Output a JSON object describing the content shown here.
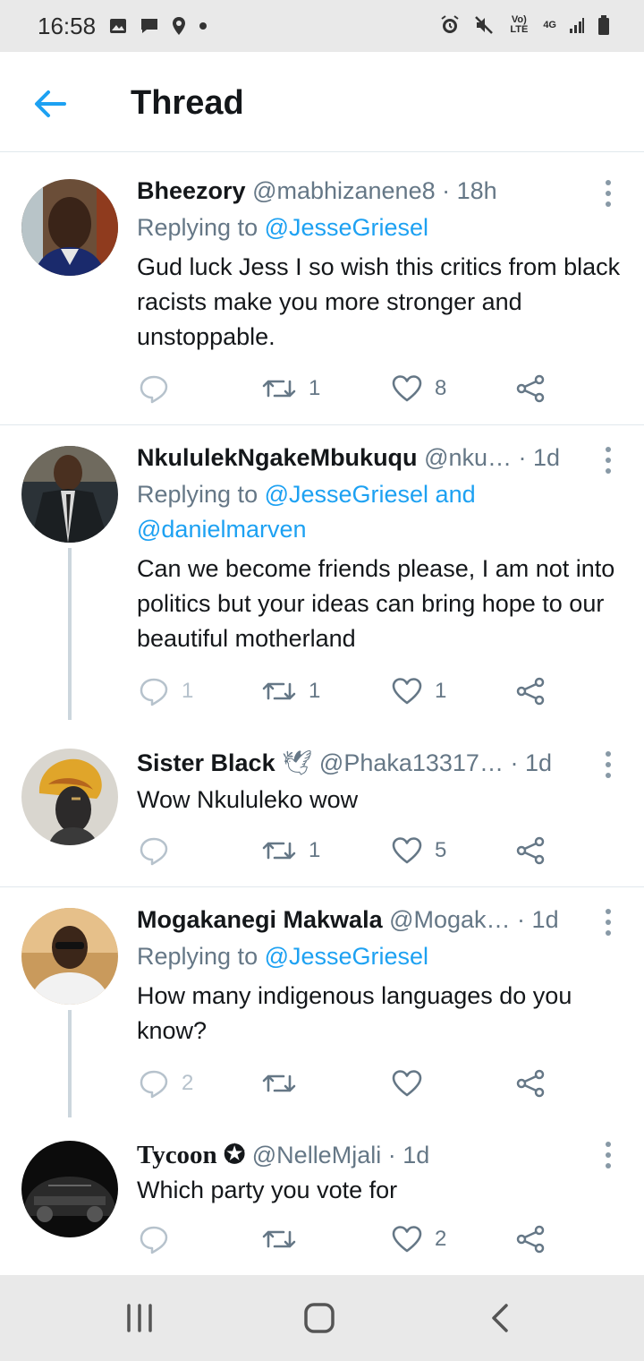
{
  "status_bar": {
    "time": "16:58",
    "left_icons": [
      "image-icon",
      "message-icon",
      "location-icon",
      "dot-icon"
    ],
    "right_icons": [
      "alarm-icon",
      "mute-icon",
      "volte-icon",
      "4g-icon",
      "signal-icon",
      "battery-icon"
    ],
    "volte_label": "Vo) LTE",
    "network_label": "4G"
  },
  "header": {
    "title": "Thread",
    "back_icon": "arrow-left-icon"
  },
  "colors": {
    "accent": "#1da1f2",
    "text": "#14171a",
    "muted": "#657786",
    "divider": "#e1e8ed",
    "thread_line": "#ccd6dd"
  },
  "tweets": [
    {
      "name": "Bheezory",
      "meta": "@mabhizanene8 · 18h",
      "replying_prefix": "Replying to ",
      "replying_to": "@JesseGriesel",
      "body": "Gud luck Jess I so wish this critics from black racists make you more stronger and unstoppable.",
      "reply_count": "",
      "retweet_count": "1",
      "like_count": "8"
    },
    {
      "name": "NkululekNgakeMbukuqu",
      "meta": "@nku… · 1d",
      "replying_prefix": "Replying to ",
      "replying_to": "@JesseGriesel and @danielmarven",
      "body": "Can we become friends please, I am not into politics but your ideas can bring hope to our beautiful motherland",
      "reply_count": "1",
      "retweet_count": "1",
      "like_count": "1"
    },
    {
      "name": "Sister Black",
      "name_emoji": "🕊",
      "meta": "@Phaka13317… · 1d",
      "body": "Wow Nkululeko wow",
      "reply_count": "",
      "retweet_count": "1",
      "like_count": "5"
    },
    {
      "name": "Mogakanegi Makwala",
      "meta": "@Mogak… · 1d",
      "replying_prefix": "Replying to ",
      "replying_to": "@JesseGriesel",
      "body": "How many indigenous languages do you know?",
      "reply_count": "2",
      "retweet_count": "",
      "like_count": ""
    },
    {
      "name": "Tycoon ✪",
      "meta": "@NelleMjali · 1d",
      "body": "Which party you vote for",
      "reply_count": "",
      "retweet_count": "",
      "like_count": "2"
    }
  ],
  "nav_bar": {
    "icons": [
      "recent-apps-icon",
      "home-icon",
      "back-icon"
    ]
  }
}
